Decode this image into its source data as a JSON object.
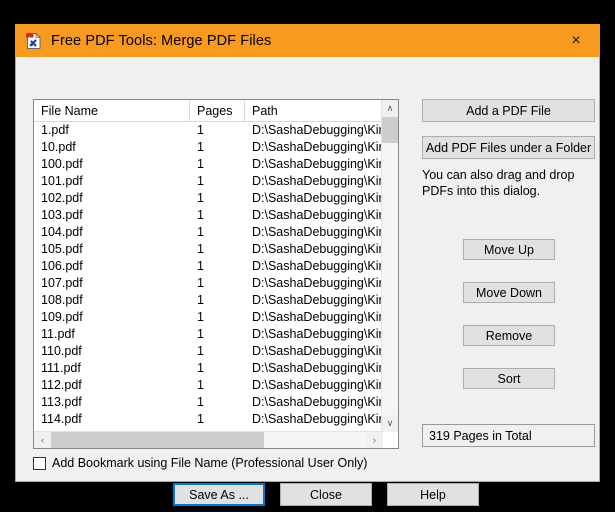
{
  "window": {
    "title": "Free PDF Tools: Merge PDF Files",
    "icon": "pdf-tools-icon",
    "close_label": "×",
    "accent_color": "#f79a1e",
    "body_color": "#f0f0f0"
  },
  "file_list": {
    "columns": [
      "File Name",
      "Pages",
      "Path"
    ],
    "rows": [
      {
        "name": "1.pdf",
        "pages": "1",
        "path": "D:\\SashaDebugging\\KiraS"
      },
      {
        "name": "10.pdf",
        "pages": "1",
        "path": "D:\\SashaDebugging\\KiraS"
      },
      {
        "name": "100.pdf",
        "pages": "1",
        "path": "D:\\SashaDebugging\\KiraS"
      },
      {
        "name": "101.pdf",
        "pages": "1",
        "path": "D:\\SashaDebugging\\KiraS"
      },
      {
        "name": "102.pdf",
        "pages": "1",
        "path": "D:\\SashaDebugging\\KiraS"
      },
      {
        "name": "103.pdf",
        "pages": "1",
        "path": "D:\\SashaDebugging\\KiraS"
      },
      {
        "name": "104.pdf",
        "pages": "1",
        "path": "D:\\SashaDebugging\\KiraS"
      },
      {
        "name": "105.pdf",
        "pages": "1",
        "path": "D:\\SashaDebugging\\KiraS"
      },
      {
        "name": "106.pdf",
        "pages": "1",
        "path": "D:\\SashaDebugging\\KiraS"
      },
      {
        "name": "107.pdf",
        "pages": "1",
        "path": "D:\\SashaDebugging\\KiraS"
      },
      {
        "name": "108.pdf",
        "pages": "1",
        "path": "D:\\SashaDebugging\\KiraS"
      },
      {
        "name": "109.pdf",
        "pages": "1",
        "path": "D:\\SashaDebugging\\KiraS"
      },
      {
        "name": "11.pdf",
        "pages": "1",
        "path": "D:\\SashaDebugging\\KiraS"
      },
      {
        "name": "110.pdf",
        "pages": "1",
        "path": "D:\\SashaDebugging\\KiraS"
      },
      {
        "name": "111.pdf",
        "pages": "1",
        "path": "D:\\SashaDebugging\\KiraS"
      },
      {
        "name": "112.pdf",
        "pages": "1",
        "path": "D:\\SashaDebugging\\KiraS"
      },
      {
        "name": "113.pdf",
        "pages": "1",
        "path": "D:\\SashaDebugging\\KiraS"
      },
      {
        "name": "114.pdf",
        "pages": "1",
        "path": "D:\\SashaDebugging\\KiraS"
      }
    ],
    "vscroll": {
      "up_glyph": "∧",
      "down_glyph": "∨"
    },
    "hscroll": {
      "left_glyph": "‹",
      "right_glyph": "›"
    }
  },
  "side_panel": {
    "add_file_label": "Add a PDF File",
    "add_folder_label": "Add PDF Files under a Folder",
    "drag_hint": "You can also drag and drop PDFs into this dialog.",
    "move_up_label": "Move Up",
    "move_down_label": "Move Down",
    "remove_label": "Remove",
    "sort_label": "Sort",
    "total_pages": "319 Pages in Total"
  },
  "footer": {
    "bookmark_label": "Add Bookmark using File Name (Professional User Only)",
    "bookmark_checked": false,
    "save_as_label": "Save As ...",
    "close_label": "Close",
    "help_label": "Help"
  }
}
